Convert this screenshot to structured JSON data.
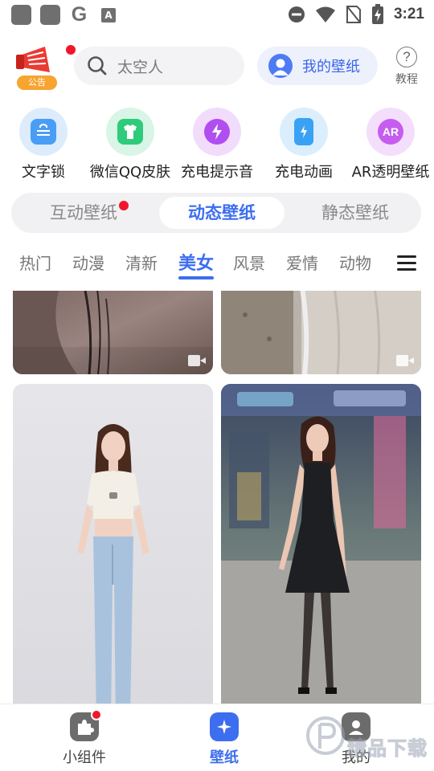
{
  "status_bar": {
    "time": "3:21",
    "app_icon_letter": "G",
    "notification_letter": "A"
  },
  "header": {
    "notice_label": "公告",
    "search_placeholder": "太空人",
    "my_wallpaper_label": "我的壁纸",
    "help_glyph": "?",
    "help_label": "教程"
  },
  "features": [
    {
      "label": "文字锁",
      "icon": "lock-bag-icon",
      "color": "#4a9df5",
      "bg": "#dcecfd"
    },
    {
      "label": "微信QQ皮肤",
      "icon": "tshirt-icon",
      "color": "#2ecb7a",
      "bg": "#d8f5e6"
    },
    {
      "label": "充电提示音",
      "icon": "bulb-icon",
      "color": "#b04ef0",
      "bg": "#f1dcfc"
    },
    {
      "label": "充电动画",
      "icon": "battery-icon",
      "color": "#3aa2f5",
      "bg": "#dbeefd"
    },
    {
      "label": "AR透明壁纸",
      "icon": "ar-icon",
      "color": "#c65cf0",
      "bg": "#f3defc",
      "icon_text": "AR"
    }
  ],
  "segments": [
    {
      "label": "互动壁纸",
      "badge": true
    },
    {
      "label": "动态壁纸",
      "active": true
    },
    {
      "label": "静态壁纸"
    }
  ],
  "categories": [
    "热门",
    "动漫",
    "清新",
    "美女",
    "风景",
    "爱情",
    "动物"
  ],
  "active_category": "美女",
  "bottom_nav": [
    {
      "label": "小组件",
      "icon": "puzzle-icon",
      "badge": true
    },
    {
      "label": "壁纸",
      "icon": "wallpaper-icon",
      "active": true
    },
    {
      "label": "我的",
      "icon": "profile-icon"
    }
  ],
  "watermark_text": "精品下载",
  "colors": {
    "accent": "#3d6ef0",
    "badge": "#f2162d"
  }
}
